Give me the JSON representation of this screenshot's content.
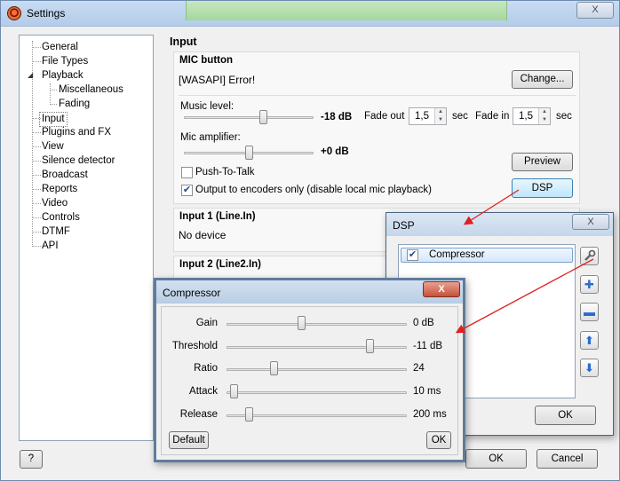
{
  "window": {
    "title": "Settings",
    "close_label": "X"
  },
  "tree": {
    "items": [
      {
        "label": "General"
      },
      {
        "label": "File Types"
      },
      {
        "label": "Playback"
      },
      {
        "label": "Miscellaneous"
      },
      {
        "label": "Fading"
      },
      {
        "label": "Input"
      },
      {
        "label": "Plugins and FX"
      },
      {
        "label": "View"
      },
      {
        "label": "Silence detector"
      },
      {
        "label": "Broadcast"
      },
      {
        "label": "Reports"
      },
      {
        "label": "Video"
      },
      {
        "label": "Controls"
      },
      {
        "label": "DTMF"
      },
      {
        "label": "API"
      }
    ],
    "selected": "Input"
  },
  "main": {
    "title": "Input",
    "mic": {
      "title": "MIC button",
      "device": "[WASAPI] Error!",
      "change_label": "Change...",
      "music_level_label": "Music level:",
      "music_level_value": "-18 dB",
      "music_level_fraction": 0.62,
      "fade_out_label": "Fade out",
      "fade_out_value": "1,5",
      "fade_in_label": "Fade in",
      "fade_in_value": "1,5",
      "sec_label": "sec",
      "mic_amp_label": "Mic amplifier:",
      "mic_amp_value": "+0 dB",
      "mic_amp_fraction": 0.5,
      "preview_label": "Preview",
      "dsp_label": "DSP",
      "push_to_talk_label": "Push-To-Talk",
      "push_to_talk_checked": false,
      "output_encoders_label": "Output to encoders only (disable local mic playback)",
      "output_encoders_checked": true
    },
    "input1": {
      "title": "Input 1 (Line.In)",
      "device": "No device"
    },
    "input2": {
      "title": "Input 2 (Line2.In)"
    }
  },
  "footer": {
    "help_label": "?",
    "ok_label": "OK",
    "cancel_label": "Cancel"
  },
  "dsp_dialog": {
    "title": "DSP",
    "close_label": "X",
    "items": [
      {
        "label": "Compressor",
        "checked": true
      }
    ],
    "ok_label": "OK",
    "icons": [
      "wrench-icon",
      "plus-icon",
      "minus-icon",
      "up-arrow-icon",
      "down-arrow-icon"
    ]
  },
  "compressor_dialog": {
    "title": "Compressor",
    "close_label": "X",
    "params": [
      {
        "label": "Gain",
        "value": "0 dB",
        "fraction": 0.41
      },
      {
        "label": "Threshold",
        "value": "-11 dB",
        "fraction": 0.81
      },
      {
        "label": "Ratio",
        "value": "24",
        "fraction": 0.25
      },
      {
        "label": "Attack",
        "value": "10 ms",
        "fraction": 0.02
      },
      {
        "label": "Release",
        "value": "200 ms",
        "fraction": 0.11
      }
    ],
    "default_label": "Default",
    "ok_label": "OK"
  },
  "colors": {
    "annotation_arrow": "#e02020",
    "title_bar": "#c8dcf2"
  }
}
